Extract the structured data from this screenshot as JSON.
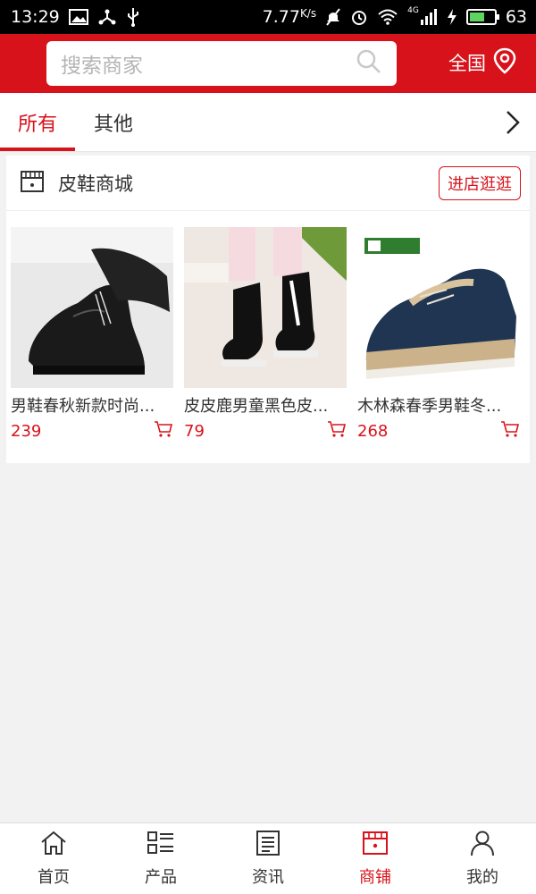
{
  "status_bar": {
    "time": "13:29",
    "speed": "7.77",
    "speed_unit": "K/s",
    "network": "4G",
    "battery": "63",
    "battery_level": 0.63
  },
  "header": {
    "search_placeholder": "搜索商家",
    "region_label": "全国",
    "accent_color": "#d8121b"
  },
  "tabs": [
    {
      "label": "所有",
      "active": true
    },
    {
      "label": "其他",
      "active": false
    }
  ],
  "shop": {
    "name": "皮鞋商城",
    "visit_label": "进店逛逛",
    "products": [
      {
        "name": "男鞋春秋新款时尚...",
        "price": "239"
      },
      {
        "name": "皮皮鹿男童黑色皮...",
        "price": "79"
      },
      {
        "name": "木林森春季男鞋冬...",
        "price": "268"
      }
    ]
  },
  "bottom_nav": [
    {
      "label": "首页",
      "icon": "home-icon",
      "active": false
    },
    {
      "label": "产品",
      "icon": "grid-list-icon",
      "active": false
    },
    {
      "label": "资讯",
      "icon": "news-icon",
      "active": false
    },
    {
      "label": "商铺",
      "icon": "store-icon",
      "active": true
    },
    {
      "label": "我的",
      "icon": "user-icon",
      "active": false
    }
  ]
}
